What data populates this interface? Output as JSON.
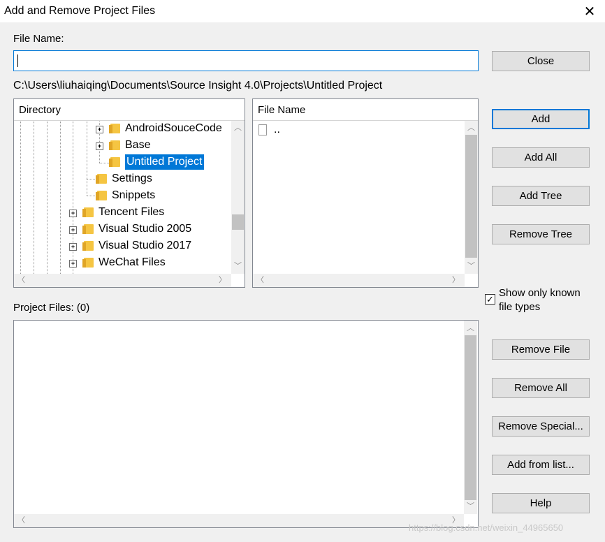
{
  "window": {
    "title": "Add and Remove Project Files",
    "close_glyph": "✕"
  },
  "file_name": {
    "label": "File Name:",
    "value": ""
  },
  "path": "C:\\Users\\liuhaiqing\\Documents\\Source Insight 4.0\\Projects\\Untitled Project",
  "directory": {
    "header": "Directory",
    "items": [
      {
        "label": "AndroidSouceCode",
        "expandable": true,
        "selected": false
      },
      {
        "label": "Base",
        "expandable": true,
        "selected": false
      },
      {
        "label": "Untitled Project",
        "expandable": false,
        "selected": true
      },
      {
        "label": "Settings",
        "expandable": false,
        "selected": false
      },
      {
        "label": "Snippets",
        "expandable": false,
        "selected": false
      },
      {
        "label": "Tencent Files",
        "expandable": true,
        "selected": false
      },
      {
        "label": "Visual Studio 2005",
        "expandable": true,
        "selected": false
      },
      {
        "label": "Visual Studio 2017",
        "expandable": true,
        "selected": false
      },
      {
        "label": "WeChat Files",
        "expandable": true,
        "selected": false
      }
    ]
  },
  "file_list": {
    "header": "File Name",
    "items": [
      {
        "label": ".."
      }
    ]
  },
  "project_files": {
    "label": "Project Files: (0)",
    "items": []
  },
  "show_only_known": {
    "label_line1": "Show only known",
    "label_line2": "file types",
    "checked": true,
    "check_glyph": "✓"
  },
  "buttons": {
    "close": "Close",
    "add": "Add",
    "add_all": "Add All",
    "add_tree": "Add Tree",
    "remove_tree": "Remove Tree",
    "remove_file": "Remove File",
    "remove_all": "Remove All",
    "remove_special": "Remove Special...",
    "add_from_list": "Add from list...",
    "help": "Help"
  },
  "scroll_glyphs": {
    "up": "︿",
    "down": "﹀",
    "left": "〈",
    "right": "〉"
  },
  "watermark": "https://blog.csdn.net/weixin_44965650"
}
